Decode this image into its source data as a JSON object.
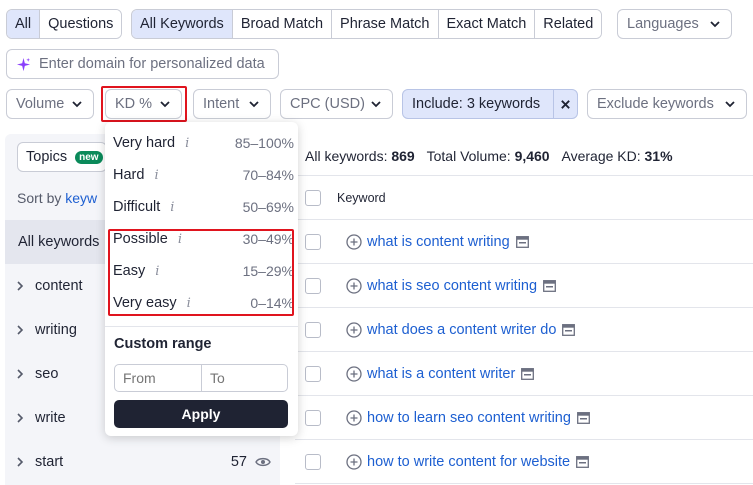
{
  "toolbar_row1": {
    "scope_tabs": [
      "All",
      "Questions"
    ],
    "match_tabs": [
      "All Keywords",
      "Broad Match",
      "Phrase Match",
      "Exact Match",
      "Related"
    ],
    "languages": "Languages"
  },
  "domain_input": {
    "placeholder": "Enter domain for personalized data"
  },
  "filters": {
    "volume": "Volume",
    "kd": "KD %",
    "intent": "Intent",
    "cpc": "CPC (USD)",
    "include": "Include: 3 keywords",
    "exclude": "Exclude keywords"
  },
  "kd_dropdown": {
    "options": [
      {
        "label": "Very hard",
        "range": "85–100%"
      },
      {
        "label": "Hard",
        "range": "70–84%"
      },
      {
        "label": "Difficult",
        "range": "50–69%"
      },
      {
        "label": "Possible",
        "range": "30–49%"
      },
      {
        "label": "Easy",
        "range": "15–29%"
      },
      {
        "label": "Very easy",
        "range": "0–14%"
      }
    ],
    "info_glyph": "i",
    "custom_range_title": "Custom range",
    "from_placeholder": "From",
    "to_placeholder": "To",
    "apply_label": "Apply"
  },
  "sidebar": {
    "topics_label": "Topics",
    "new_badge": "new",
    "sort_prefix": "Sort by",
    "sort_value": "keyw",
    "all_keywords": "All keywords",
    "items": [
      {
        "label": "content"
      },
      {
        "label": "writing"
      },
      {
        "label": "seo"
      },
      {
        "label": "write"
      },
      {
        "label": "start",
        "count": "57"
      }
    ]
  },
  "summary": {
    "all_keywords_label": "All keywords:",
    "all_keywords_value": "869",
    "total_volume_label": "Total Volume:",
    "total_volume_value": "9,460",
    "avg_kd_label": "Average KD:",
    "avg_kd_value": "31%"
  },
  "table": {
    "keyword_header": "Keyword",
    "rows": [
      "what is content writing",
      "what is seo content writing",
      "what does a content writer do",
      "what is a content writer",
      "how to learn seo content writing",
      "how to write content for website"
    ]
  },
  "colors": {
    "accent": "#1d5fd1",
    "highlight": "#e0141e",
    "active_tab": "#dfe6fb",
    "new_badge": "#0a8a5a"
  },
  "icons": [
    "chevron-down-icon",
    "sparkle-icon",
    "close-icon",
    "info-icon",
    "chevron-right-icon",
    "eye-icon",
    "plus-circle-icon",
    "serp-icon"
  ]
}
